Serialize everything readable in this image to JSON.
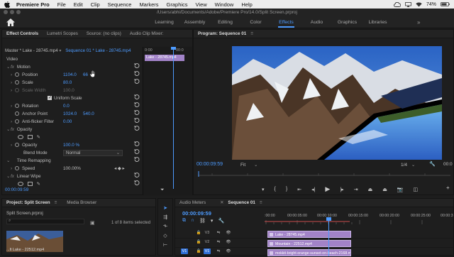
{
  "menubar": {
    "app_name": "Premiere Pro",
    "items": [
      "File",
      "Edit",
      "Clip",
      "Sequence",
      "Markers",
      "Graphics",
      "View",
      "Window",
      "Help"
    ],
    "battery": "74%"
  },
  "titlebar": {
    "path": "/Users/abhi/Documents/Adobe/Premiere Pro/14.0/Split Screen.prproj"
  },
  "workspaces": {
    "tabs": [
      "Learning",
      "Assembly",
      "Editing",
      "Color",
      "Effects",
      "Audio",
      "Graphics",
      "Libraries"
    ],
    "active": "Effects"
  },
  "effect_controls": {
    "tabs": [
      "Effect Controls",
      "Lumetri Scopes",
      "Source: (no clips)",
      "Audio Clip Mixer:"
    ],
    "master": "Master * Lake - 28745.mp4",
    "sequence": "Sequence 01 * Lake - 28745.mp4",
    "section_video": "Video",
    "motion": "Motion",
    "position_label": "Position",
    "position_x": "1104.0",
    "position_y": "66",
    "scale_label": "Scale",
    "scale_val": "80.0",
    "scale_width_label": "Scale Width",
    "scale_width_val": "100.0",
    "uniform_label": "Uniform Scale",
    "rotation_label": "Rotation",
    "rotation_val": "0.0",
    "anchor_label": "Anchor Point",
    "anchor_x": "1024.0",
    "anchor_y": "540.0",
    "antiflicker_label": "Anti-flicker Filter",
    "antiflicker_val": "0.00",
    "opacity_section": "Opacity",
    "opacity_label": "Opacity",
    "opacity_val": "100.0 %",
    "blend_label": "Blend Mode",
    "blend_val": "Normal",
    "time_remap": "Time Remapping",
    "speed_label": "Speed",
    "speed_val": "100.00%",
    "linear_wipe": "Linear Wipe",
    "timecode": "00:00:09:59",
    "mini_tc": "0:00",
    "mini_tc2": "00:0",
    "mini_clip": "Lake - 28745.mp4"
  },
  "program": {
    "title": "Program: Sequence 01",
    "timecode": "00:00:09:59",
    "fit": "Fit",
    "fraction": "1/4",
    "end_tc": "00:0"
  },
  "project": {
    "tabs": [
      "Project: Split Screen",
      "Media Browser"
    ],
    "file": "Split Screen.prproj",
    "count": "1 of 8 items selected",
    "thumb_label": "...lt Lake - 22512.mp4"
  },
  "timeline": {
    "tabs": [
      "Audio Meters",
      "Sequence 01"
    ],
    "timecode": "00:00:09:59",
    "ruler": [
      ":00:00",
      "00:00:05:00",
      "00:00:10:00",
      "00:00:15:00",
      "00:00:20:00",
      "00:00:25:00",
      "00:00:3"
    ],
    "tracks": [
      "V3",
      "V2",
      "V1"
    ],
    "clip_v3": "Lake - 28745.mp4",
    "clip_v2": "Mountain - 22512.mp4",
    "clip_v1": "mokkit-bright-orange-sunset-on-beach-2168.m"
  },
  "colors": {
    "accent": "#4d9bff",
    "clip": "#a283c8",
    "playhead": "#4d9bff"
  }
}
